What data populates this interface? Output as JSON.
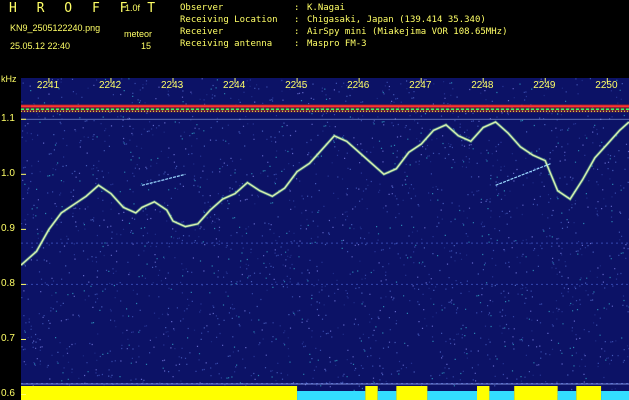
{
  "header": {
    "brand": "H R O F F T",
    "version": "1.0f",
    "filename": "KN9_2505122240.png",
    "timestamp": "25.05.12 22:40",
    "mode": "meteor",
    "gain": "15"
  },
  "info": [
    {
      "key": "Observer",
      "value": "K.Nagai"
    },
    {
      "key": "Receiving Location",
      "value": "Chigasaki, Japan (139.414 35.340)"
    },
    {
      "key": "Receiver",
      "value": "AirSpy mini (Miakejima VOR 108.65MHz)"
    },
    {
      "key": "Receiving antenna",
      "value": "Maspro FM-3"
    }
  ],
  "colors": {
    "background": "#0c1266",
    "text": "#ffff66",
    "trace": "#d9f0b0",
    "bar": "#ffff00",
    "bar_low": "#33ddff"
  },
  "chart_data": {
    "type": "spectrogram",
    "ylabel": "kHz",
    "x_ticks": [
      "2241",
      "2242",
      "2243",
      "2244",
      "2245",
      "2246",
      "2247",
      "2248",
      "2249",
      "2250"
    ],
    "y_ticks": [
      "1.1",
      "1.0",
      "0.9",
      "0.8",
      "0.7",
      "0.6"
    ],
    "ylim": [
      0.59,
      1.175
    ],
    "xlim": [
      2240.55,
      2250.35
    ],
    "carrier_khz": 1.12,
    "trace": {
      "x": [
        2240.55,
        2240.8,
        2241.0,
        2241.2,
        2241.4,
        2241.6,
        2241.8,
        2242.0,
        2242.2,
        2242.4,
        2242.5,
        2242.7,
        2242.9,
        2243.0,
        2243.2,
        2243.4,
        2243.6,
        2243.8,
        2244.0,
        2244.2,
        2244.4,
        2244.6,
        2244.8,
        2245.0,
        2245.2,
        2245.4,
        2245.6,
        2245.8,
        2246.0,
        2246.2,
        2246.4,
        2246.6,
        2246.8,
        2247.0,
        2247.2,
        2247.4,
        2247.6,
        2247.8,
        2248.0,
        2248.2,
        2248.4,
        2248.6,
        2248.8,
        2249.0,
        2249.2,
        2249.4,
        2249.6,
        2249.8,
        2250.0,
        2250.2,
        2250.35
      ],
      "y": [
        0.835,
        0.86,
        0.9,
        0.93,
        0.945,
        0.96,
        0.98,
        0.965,
        0.94,
        0.93,
        0.94,
        0.95,
        0.935,
        0.915,
        0.905,
        0.91,
        0.935,
        0.955,
        0.965,
        0.985,
        0.97,
        0.96,
        0.975,
        1.005,
        1.02,
        1.045,
        1.07,
        1.06,
        1.04,
        1.02,
        1.0,
        1.01,
        1.04,
        1.055,
        1.08,
        1.09,
        1.07,
        1.06,
        1.085,
        1.095,
        1.075,
        1.05,
        1.035,
        1.025,
        0.97,
        0.955,
        0.99,
        1.03,
        1.055,
        1.08,
        1.095
      ]
    },
    "streaks": [
      {
        "x": [
          2242.5,
          2243.2
        ],
        "y": [
          0.98,
          1.0
        ]
      },
      {
        "x": [
          2248.2,
          2249.1
        ],
        "y": [
          0.98,
          1.02
        ]
      }
    ],
    "bottom_bar_segments": [
      {
        "x": [
          2240.55,
          2245.0
        ],
        "level": "high"
      },
      {
        "x": [
          2245.0,
          2246.1
        ],
        "level": "low"
      },
      {
        "x": [
          2246.1,
          2246.3
        ],
        "level": "high"
      },
      {
        "x": [
          2246.3,
          2246.6
        ],
        "level": "low"
      },
      {
        "x": [
          2246.6,
          2247.1
        ],
        "level": "high"
      },
      {
        "x": [
          2247.1,
          2247.9
        ],
        "level": "low"
      },
      {
        "x": [
          2247.9,
          2248.1
        ],
        "level": "high"
      },
      {
        "x": [
          2248.1,
          2248.5
        ],
        "level": "low"
      },
      {
        "x": [
          2248.5,
          2249.2
        ],
        "level": "high"
      },
      {
        "x": [
          2249.2,
          2249.5
        ],
        "level": "low"
      },
      {
        "x": [
          2249.5,
          2249.9
        ],
        "level": "high"
      },
      {
        "x": [
          2249.9,
          2250.35
        ],
        "level": "low"
      }
    ]
  }
}
